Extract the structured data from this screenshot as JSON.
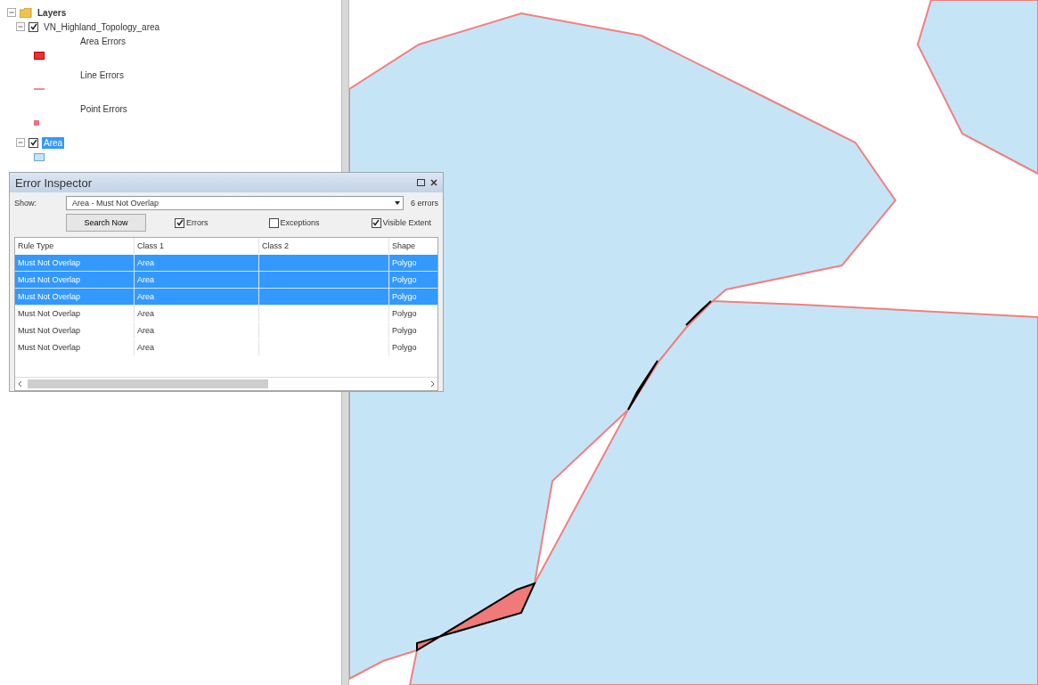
{
  "toc": {
    "root": {
      "label": "Layers",
      "expanded": true
    },
    "layers": [
      {
        "label": "VN_Highland_Topology_area",
        "checked": true,
        "expanded": true,
        "selected": false,
        "legend": [
          {
            "kind": "area",
            "label": "Area Errors"
          },
          {
            "kind": "line",
            "label": "Line Errors"
          },
          {
            "kind": "point",
            "label": "Point Errors"
          }
        ]
      },
      {
        "label": "Area",
        "checked": true,
        "expanded": true,
        "selected": true,
        "legend": [
          {
            "kind": "fill"
          }
        ]
      }
    ]
  },
  "error_inspector": {
    "title": "Error Inspector",
    "show_label": "Show:",
    "show_value": "Area - Must Not Overlap",
    "count": "6 errors",
    "search_button": "Search Now",
    "options": [
      {
        "label": "Errors",
        "checked": true
      },
      {
        "label": "Exceptions",
        "checked": false
      },
      {
        "label": "Visible Extent",
        "checked": true
      }
    ],
    "columns": [
      "Rule Type",
      "Class 1",
      "Class 2",
      "Shape"
    ],
    "rows": [
      {
        "cells": [
          "Must Not Overlap",
          "Area",
          "",
          "Polygo"
        ],
        "selected": true
      },
      {
        "cells": [
          "Must Not Overlap",
          "Area",
          "",
          "Polygo"
        ],
        "selected": true
      },
      {
        "cells": [
          "Must Not Overlap",
          "Area",
          "",
          "Polygo"
        ],
        "selected": true
      },
      {
        "cells": [
          "Must Not Overlap",
          "Area",
          "",
          "Polygo"
        ],
        "selected": false
      },
      {
        "cells": [
          "Must Not Overlap",
          "Area",
          "",
          "Polygo"
        ],
        "selected": false
      },
      {
        "cells": [
          "Must Not Overlap",
          "Area",
          "",
          "Polygo"
        ],
        "selected": false
      }
    ]
  }
}
